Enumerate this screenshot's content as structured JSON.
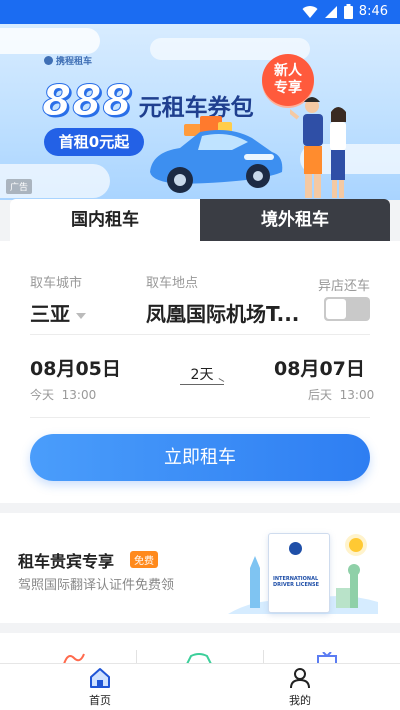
{
  "status_bar": {
    "time": "8:46"
  },
  "banner": {
    "brand": "携程租车",
    "promo_amount": "888",
    "promo_text": "元租车券包",
    "promo_pill": "首租0元起",
    "new_badge_line1": "新人",
    "new_badge_line2": "专享",
    "ad_label": "广告"
  },
  "tabs": [
    {
      "label": "国内租车"
    },
    {
      "label": "境外租车"
    }
  ],
  "booking": {
    "pickup_city_label": "取车城市",
    "pickup_city": "三亚",
    "pickup_location_label": "取车地点",
    "pickup_location": "凤凰国际机场T...",
    "return_other_label": "异店还车",
    "return_other_on": false,
    "pickup_date": "08月05日",
    "pickup_day": "今天",
    "pickup_time": "13:00",
    "duration": "2天",
    "return_date": "08月07日",
    "return_day": "后天",
    "return_time": "13:00",
    "submit_label": "立即租车"
  },
  "vip": {
    "title": "租车贵宾专享",
    "badge": "免费",
    "subtitle": "驾照国际翻译认证件免费领",
    "card_text": "INTERNATIONAL DRIVER LICENSE"
  },
  "bottom_nav": [
    {
      "label": "首页"
    },
    {
      "label": "我的"
    }
  ],
  "colors": {
    "accent": "#2e7ef2",
    "status_bar": "#1b6cf2",
    "badge": "#ff5a3c",
    "free": "#ff8a1d",
    "active_tab_dark": "#3a3d44"
  }
}
